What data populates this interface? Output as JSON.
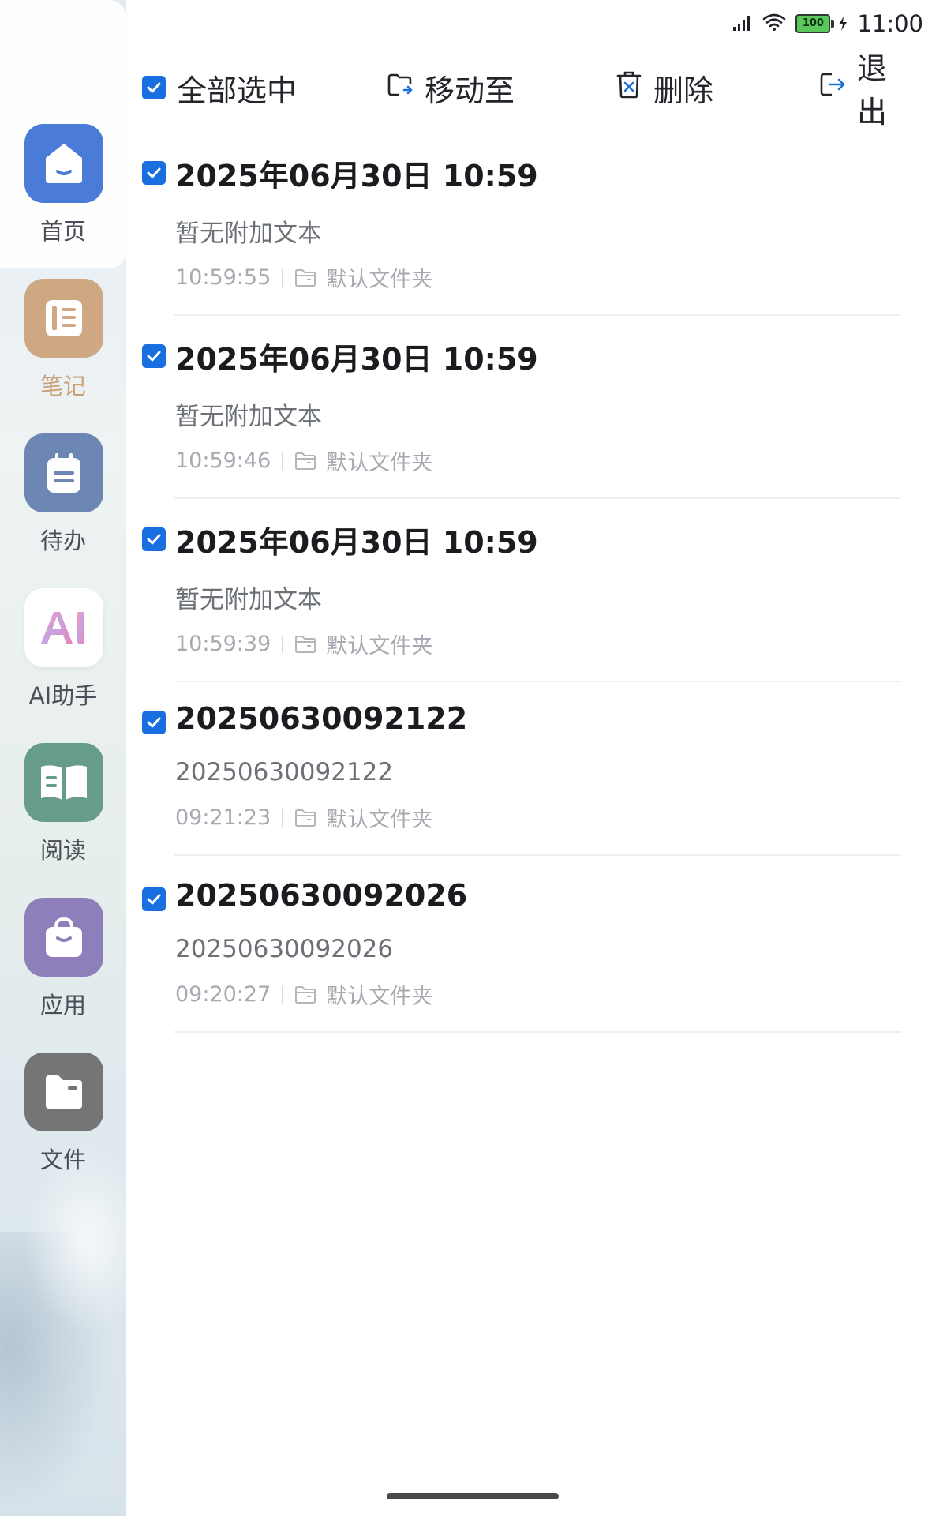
{
  "status_bar": {
    "battery": "100",
    "time": "11:00"
  },
  "toolbar": {
    "select_all": "全部选中",
    "move_to": "移动至",
    "delete": "删除",
    "exit": "退出"
  },
  "sidebar": {
    "items": [
      {
        "label": "首页",
        "icon": "home-icon",
        "color": "#4a7bd6"
      },
      {
        "label": "笔记",
        "icon": "notebook-icon",
        "color": "#cda883"
      },
      {
        "label": "待办",
        "icon": "todo-icon",
        "color": "#6d86b3"
      },
      {
        "label": "AI助手",
        "icon": "ai-icon",
        "color": "#ffffff"
      },
      {
        "label": "阅读",
        "icon": "book-icon",
        "color": "#679b8b"
      },
      {
        "label": "应用",
        "icon": "bag-icon",
        "color": "#8e7fba"
      },
      {
        "label": "文件",
        "icon": "folder-icon",
        "color": "#737577"
      }
    ]
  },
  "notes": [
    {
      "title": "2025年06月30日 10:59",
      "summary": "暂无附加文本",
      "time": "10:59:55",
      "folder": "默认文件夹"
    },
    {
      "title": "2025年06月30日 10:59",
      "summary": "暂无附加文本",
      "time": "10:59:46",
      "folder": "默认文件夹"
    },
    {
      "title": "2025年06月30日 10:59",
      "summary": "暂无附加文本",
      "time": "10:59:39",
      "folder": "默认文件夹"
    },
    {
      "title": "20250630092122",
      "summary": "20250630092122",
      "time": "09:21:23",
      "folder": "默认文件夹"
    },
    {
      "title": "20250630092026",
      "summary": "20250630092026",
      "time": "09:20:27",
      "folder": "默认文件夹"
    }
  ],
  "colors": {
    "accent": "#1a6fe0",
    "text_primary": "#1a1c1f",
    "text_secondary": "#6c7077",
    "text_meta": "#a6aab0"
  }
}
